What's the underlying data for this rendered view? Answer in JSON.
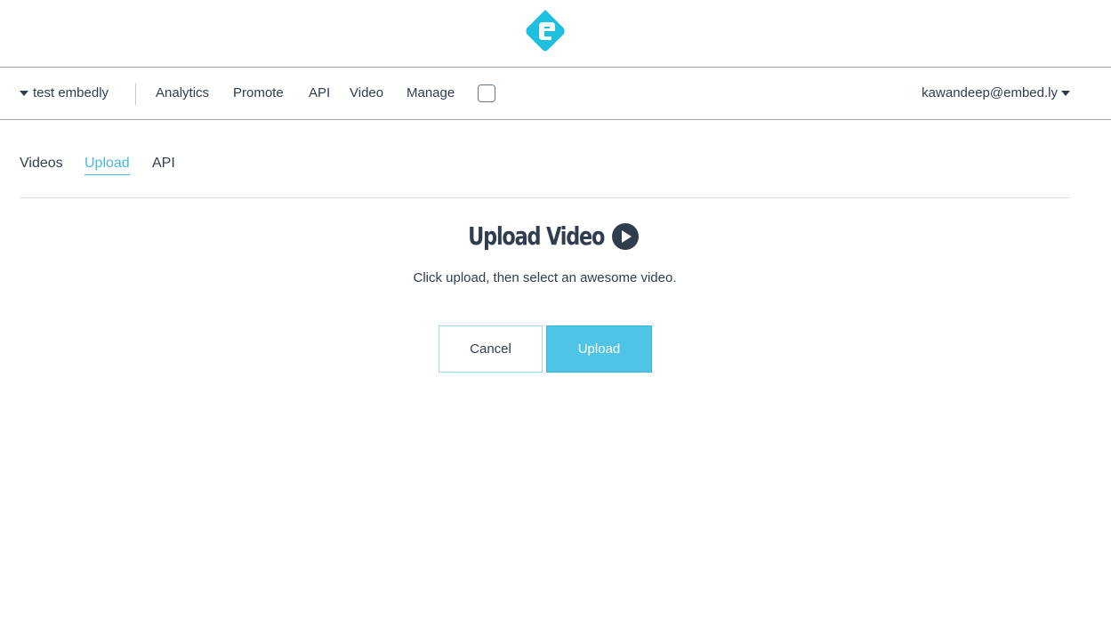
{
  "brand": {
    "logo_icon": "embedly-logo-icon",
    "accent_color": "#4ab8d9",
    "button_color": "#4fc4e6"
  },
  "nav": {
    "account": "test embedly",
    "items": [
      "Analytics",
      "Promote",
      "API",
      "Video",
      "Manage"
    ],
    "user": "kawandeep@embed.ly"
  },
  "tabs": {
    "items": [
      "Videos",
      "Upload",
      "API"
    ],
    "active": "Upload"
  },
  "main": {
    "title": "Upload Video",
    "title_icon": "play-circle-icon",
    "subtitle": "Click upload, then select an awesome video.",
    "cancel_label": "Cancel",
    "upload_label": "Upload"
  }
}
